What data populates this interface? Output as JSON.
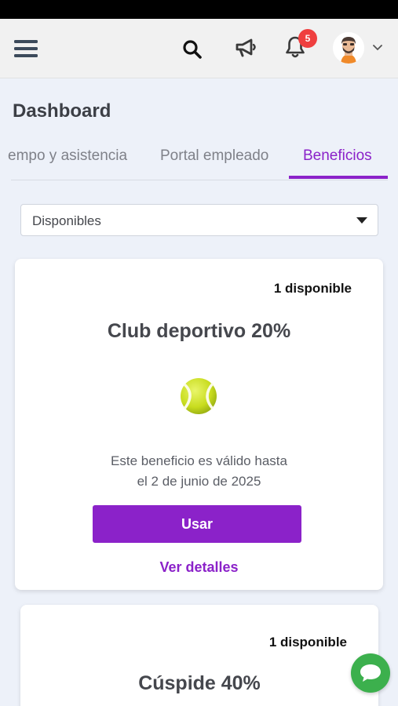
{
  "header": {
    "notifications_count": "5",
    "icons": [
      "menu-icon",
      "search-icon",
      "megaphone-icon",
      "bell-icon",
      "avatar",
      "chevron-down-icon"
    ]
  },
  "page": {
    "title": "Dashboard"
  },
  "tabs": [
    {
      "label": "empo y asistencia"
    },
    {
      "label": "Portal empleado"
    },
    {
      "label": "Beneficios",
      "active": true
    }
  ],
  "filter": {
    "selected": "Disponibles"
  },
  "benefits": [
    {
      "availability": "1 disponible",
      "title": "Club deportivo 20%",
      "icon": "tennis-ball-icon",
      "validity_line1": "Este beneficio es válido hasta",
      "validity_line2": "el 2 de junio de 2025",
      "use_label": "Usar",
      "details_label": "Ver detalles"
    },
    {
      "availability": "1 disponible",
      "title": "Cúspide 40%"
    }
  ],
  "colors": {
    "accent": "#8b22c9",
    "badge": "#ef3f3f",
    "chat": "#3cb04d"
  }
}
